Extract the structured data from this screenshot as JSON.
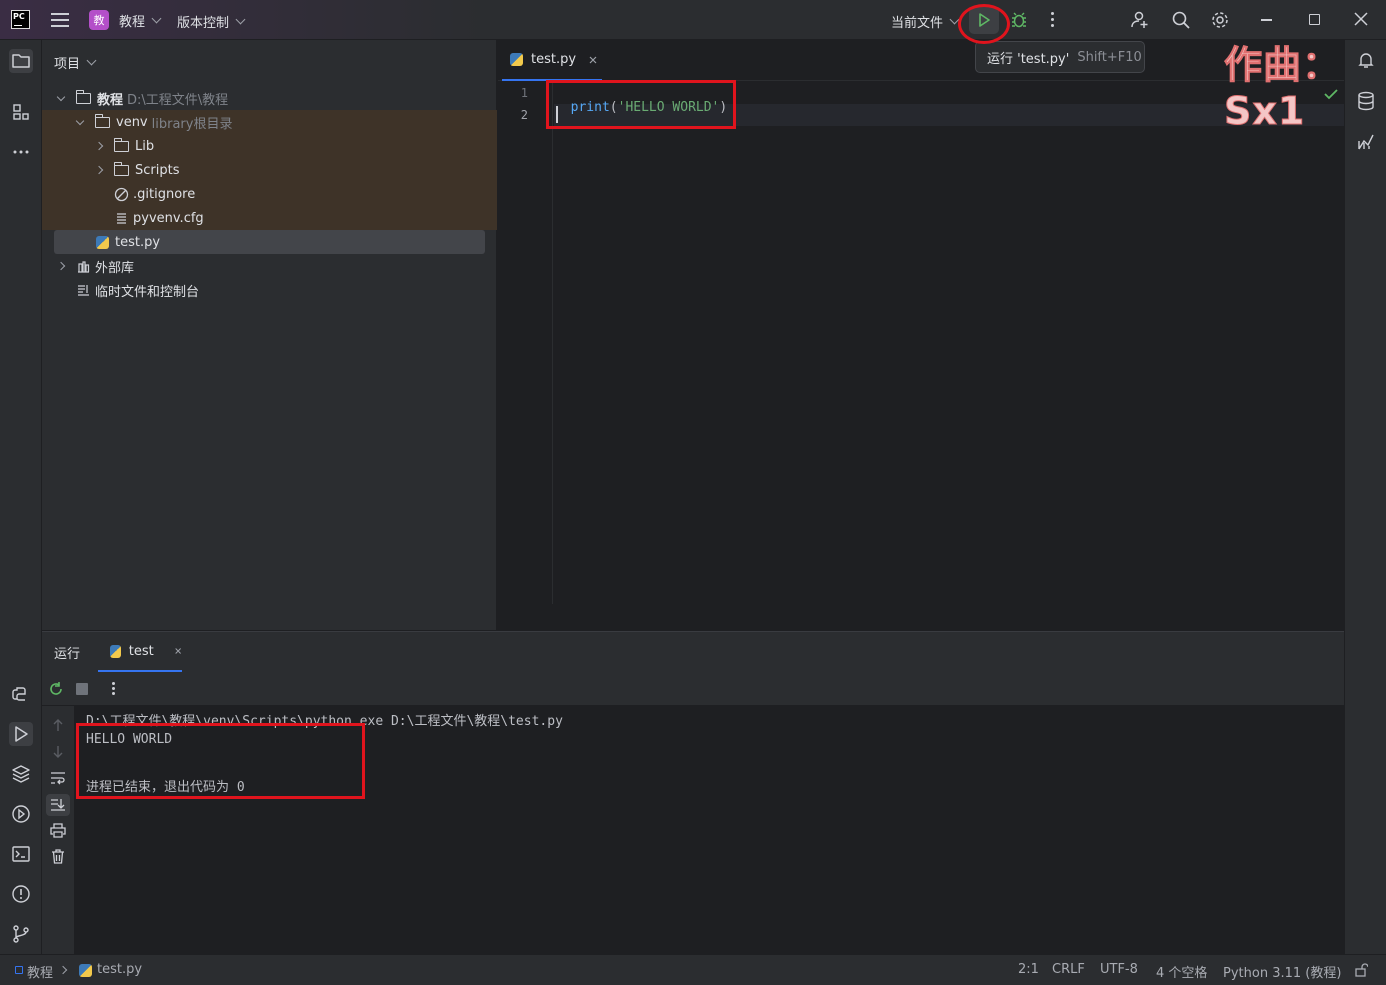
{
  "titlebar": {
    "logo": "PC",
    "project_badge": "教",
    "project_name": "教程",
    "vcs_label": "版本控制",
    "run_config": "当前文件"
  },
  "tooltip": {
    "text": "运行 'test.py'",
    "shortcut": "Shift+F10"
  },
  "watermark": "作曲：Sx1",
  "project_panel": {
    "title": "项目",
    "tree": {
      "root_name": "教程",
      "root_path": "D:\\工程文件\\教程",
      "venv_name": "venv",
      "venv_hint": "library根目录",
      "lib": "Lib",
      "scripts": "Scripts",
      "gitignore": ".gitignore",
      "pyvenv": "pyvenv.cfg",
      "testpy": "test.py",
      "external_libs": "外部库",
      "scratches": "临时文件和控制台"
    }
  },
  "editor": {
    "tab_label": "test.py",
    "lines": [
      {
        "number": "1",
        "func": "print",
        "open": "(",
        "string": "'HELLO WORLD'",
        "close": ")"
      },
      {
        "number": "2"
      }
    ]
  },
  "run_panel": {
    "title": "运行",
    "tab_label": "test",
    "output": {
      "command": "D:\\工程文件\\教程\\venv\\Scripts\\python.exe D:\\工程文件\\教程\\test.py",
      "result": "HELLO WORLD",
      "exit_message": "进程已结束，退出代码为 0"
    }
  },
  "statusbar": {
    "breadcrumb_project": "教程",
    "breadcrumb_file": "test.py",
    "position": "2:1",
    "line_ending": "CRLF",
    "encoding": "UTF-8",
    "indent": "4 个空格",
    "interpreter": "Python 3.11 (教程)"
  },
  "colors": {
    "accent": "#3574f0",
    "run_green": "#5fb865",
    "highlight_red": "#e0141d",
    "string_green": "#6aab73",
    "keyword_blue": "#56a8f5"
  }
}
